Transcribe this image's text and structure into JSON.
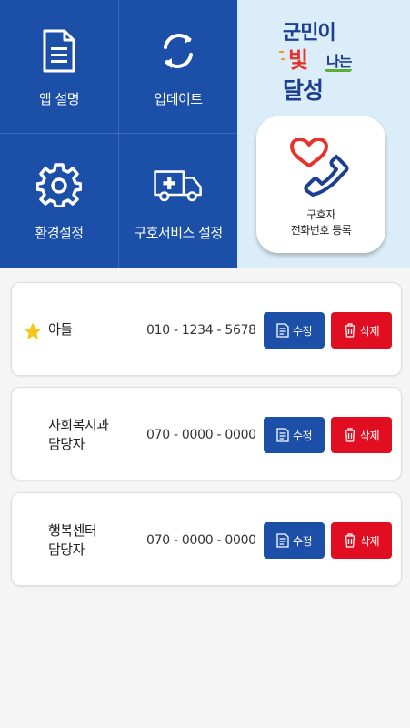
{
  "menu": {
    "app_info": "앱 설명",
    "update": "업데이트",
    "settings": "환경설정",
    "rescue_settings": "구호서비스 설정"
  },
  "logo": {
    "line1": "군민이",
    "line2_big": "빛",
    "line2_small": "나는",
    "line3": "달성"
  },
  "register": {
    "line1": "구호자",
    "line2": "전화번호 등록"
  },
  "contacts": [
    {
      "name": "아들",
      "phone": "010 - 1234 - 5678",
      "starred": true
    },
    {
      "name": "사회복지과\n담당자",
      "phone": "070 - 0000 - 0000",
      "starred": false
    },
    {
      "name": "행복센터\n담당자",
      "phone": "070 - 0000 - 0000",
      "starred": false
    }
  ],
  "buttons": {
    "edit": "수정",
    "delete": "삭제"
  },
  "colors": {
    "primary": "#1c4fa8",
    "danger": "#e10e22",
    "side_bg": "#dbedf8",
    "star": "#f5c518"
  },
  "icons": [
    "document-icon",
    "refresh-icon",
    "gear-icon",
    "ambulance-icon",
    "heart-phone-icon",
    "star-icon",
    "edit-icon",
    "trash-icon"
  ]
}
